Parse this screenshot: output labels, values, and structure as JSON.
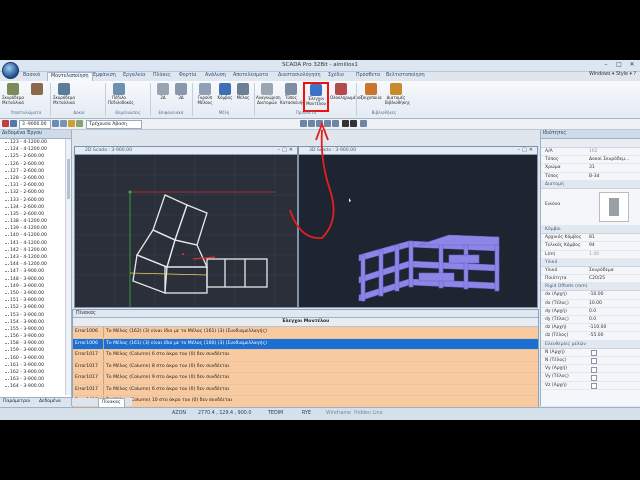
{
  "window": {
    "title": "SCADA Pro 32Bit - aimilios1",
    "controls": [
      "–",
      "□",
      "✕"
    ]
  },
  "ribbon_tabs": [
    "Βασικά",
    "Μοντελοποίηση",
    "Εμφάνιση",
    "Εργαλεία",
    "Πλάκες",
    "Φορτία",
    "Ανάλυση",
    "Αποτελέσματα",
    "Διαστασιολόγηση",
    "Σχέδιο",
    "Πρόσθετα",
    "Βελτιστοποίηση"
  ],
  "active_tab": "Μοντελοποίηση",
  "style_menu": "Windows ▾  Style ▾  ?",
  "ribbon_buttons": [
    {
      "label": "Σκυρόδεμα Μεταλλικά",
      "color": "#7a8a5a"
    },
    {
      "label": "Σκυρόδεμα Μεταλλικά",
      "color": "#5b7d9a"
    },
    {
      "label": "Πέδιλο Πεδιλοδοκός",
      "color": "#6f8fb0"
    },
    {
      "label": "2Δ",
      "color": "#9aa4b0"
    },
    {
      "label": "3Δ",
      "color": "#8897aa"
    },
    {
      "label": "Γκρούπ Μέλους",
      "color": "#8fa0b5"
    },
    {
      "label": "Κόμβος",
      "color": "#3d6fb5"
    },
    {
      "label": "Μέλος",
      "color": "#6d7f92"
    },
    {
      "label": "Αναγνώριση Διατομών",
      "color": "#9aa6b2"
    },
    {
      "label": "Τύπος Κατασκευής",
      "color": "#7d8ea3"
    },
    {
      "label": "Έλεγχοι Μοντέλου",
      "color": "#3d72c6"
    },
    {
      "label": "Ολοκληρωμένος",
      "color": "#b34b4b"
    },
    {
      "label": "Τοιχοποιία",
      "color": "#c9752e"
    },
    {
      "label": "Διατομές Βιβλιοθήκης",
      "color": "#c98a2e"
    }
  ],
  "ribbon_groups": [
    "Υποστυλώματα",
    "Δοκοί",
    "Θεμελιώσεις",
    "Επιφανειακά",
    "Μέλη",
    "Προσθετα",
    "Βιβλιοθήκες"
  ],
  "toolbar": {
    "level_value": "3 -9000.00",
    "view_combo": "Τρέχουσα Άβαση"
  },
  "left_panel": {
    "title": "Δεδομένα Έργου",
    "tree": [
      "123 - 4-1200.00",
      "124 - 4-1200.00",
      "125 - 2-600.00",
      "126 - 2-600.00",
      "127 - 2-600.00",
      "128 - 2-600.00",
      "131 - 2-600.00",
      "132 - 2-600.00",
      "133 - 2-600.00",
      "134 - 2-600.00",
      "135 - 2-600.00",
      "138 - 4-1200.00",
      "139 - 4-1200.00",
      "140 - 4-1200.00",
      "141 - 4-1200.00",
      "142 - 4-1200.00",
      "143 - 4-1200.00",
      "144 - 4-1200.00",
      "147 - 3-900.00",
      "148 - 3-900.00",
      "149 - 3-900.00",
      "150 - 3-900.00",
      "151 - 3-900.00",
      "152 - 3-900.00",
      "153 - 3-900.00",
      "154 - 3-900.00",
      "155 - 3-900.00",
      "156 - 3-900.00",
      "158 - 3-900.00",
      "159 - 3-900.00",
      "160 - 3-900.00",
      "161 - 3-900.00",
      "162 - 3-900.00",
      "163 - 3-900.00",
      "164 - 3-900.00"
    ],
    "bottom_tabs": [
      "Παράμετροι",
      "Δεδομένα"
    ]
  },
  "views": {
    "view2d_title": "2D Scada : 3-900.00",
    "view3d_title": "3D Scada : 3-900.00"
  },
  "output_panel": {
    "title": "Πίνακας",
    "header": "Έλεγχοι Μοντέλου",
    "rows": [
      {
        "code": "Error1006",
        "msg": "Το Μέλος (162) (3) είναι ίδιο με το Μέλος (161) (3) (Συνδιαμελλαγής)"
      },
      {
        "code": "Error1006",
        "msg": "Το Μέλος (161) (3) είναι ίδιο με το Μέλος (160) (3) (Συνδιαμελλαγής)"
      },
      {
        "code": "Error1017",
        "msg": "Το Μέλος (Column) 6 στο άκρο του (0) δεν συνδέεται"
      },
      {
        "code": "Error1017",
        "msg": "Το Μέλος (Column) 8 στο άκρο του (0) δεν συνδέεται"
      },
      {
        "code": "Error1017",
        "msg": "Το Μέλος (Column) 9 στο άκρο του (0) δεν συνδέεται"
      },
      {
        "code": "Error1017",
        "msg": "Το Μέλος (Column) 6 στο άκρο του (0) δεν συνδέεται"
      },
      {
        "code": "Error1017",
        "msg": "Το Μέλος (Column) 10 στο άκρο του (0) δεν συνδέεται"
      }
    ],
    "selected_index": 1,
    "footer_tab": "Πίνακας"
  },
  "right_panel": {
    "title": "Ιδιότητες",
    "props_top": [
      {
        "label": "Α/Α",
        "value": "162",
        "dim": true
      },
      {
        "label": "Τύπος",
        "value": "Δοκοί Σκυρόδεμ..."
      },
      {
        "label": "Χρώμα",
        "value": "31"
      },
      {
        "label": "Τύπος",
        "value": "B-3d"
      }
    ],
    "section_diatomi": "Διατομή",
    "image_label": "Εικόνα",
    "section_nodes": "Κόμβοι",
    "props_nodes": [
      {
        "label": "Αρχικός Κόμβος",
        "value": "81"
      },
      {
        "label": "Τελικός Κόμβος",
        "value": "94"
      },
      {
        "label": "L(m)",
        "value": "1.40",
        "dim": true
      }
    ],
    "section_material": "Υλικό",
    "props_material": [
      {
        "label": "Υλικό",
        "value": "Σκυρόδεμα"
      },
      {
        "label": "Ποιότητα",
        "value": "C20/25"
      }
    ],
    "section_offsets": "Rigid Offsets (mm)",
    "props_offsets": [
      {
        "label": "dx (Αρχή)",
        "value": "-10.00"
      },
      {
        "label": "dx (Τέλος)",
        "value": "10.00"
      },
      {
        "label": "dy (Αρχή)",
        "value": "0.0"
      },
      {
        "label": "dy (Τέλος)",
        "value": "0.0"
      },
      {
        "label": "dz (Αρχή)",
        "value": "-110.00"
      },
      {
        "label": "dz (Τέλος)",
        "value": "-55.00"
      }
    ],
    "section_release": "Ελευθερίες μελών",
    "props_release": [
      "N (Αρχή)",
      "N (Τέλος)",
      "Vy (Αρχή)",
      "Vy (Τέλος)",
      "Vz (Αρχή)"
    ]
  },
  "status_bar": {
    "snap": "AZON",
    "coords": "2770.4 , 129.4 , 900.0",
    "mode1": "TEDIM",
    "mode2": "RYE",
    "mode3": "Wireframe",
    "mode4": "Hidden Line"
  }
}
